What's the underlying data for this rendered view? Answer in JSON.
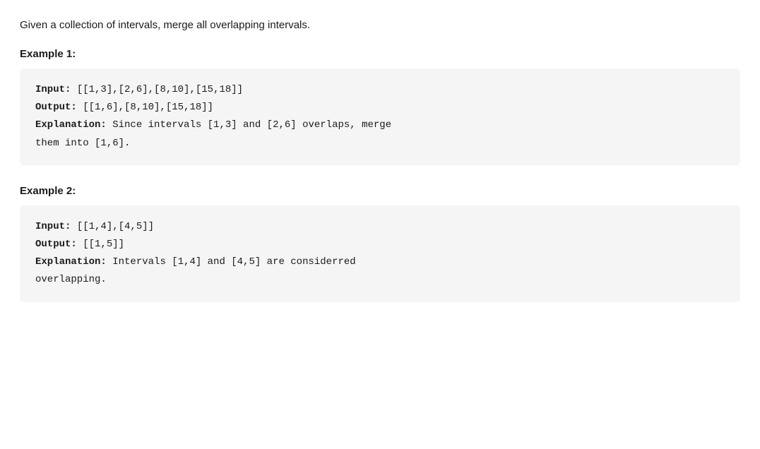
{
  "page": {
    "intro": "Given a collection of intervals, merge all overlapping intervals.",
    "example1": {
      "heading": "Example 1:",
      "input_label": "Input:",
      "input_value": " [[1,3],[2,6],[8,10],[15,18]]",
      "output_label": "Output:",
      "output_value": " [[1,6],[8,10],[15,18]]",
      "explanation_label": "Explanation:",
      "explanation_value": " Since intervals [1,3] and [2,6] overlaps, merge",
      "explanation_line2": "them into [1,6]."
    },
    "example2": {
      "heading": "Example 2:",
      "input_label": "Input:",
      "input_value": " [[1,4],[4,5]]",
      "output_label": "Output:",
      "output_value": " [[1,5]]",
      "explanation_label": "Explanation:",
      "explanation_value": " Intervals [1,4] and [4,5] are considerred",
      "explanation_line2": "overlapping."
    }
  }
}
